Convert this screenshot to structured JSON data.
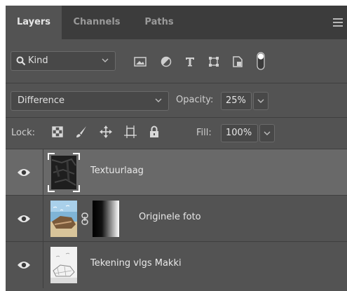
{
  "tabs": [
    {
      "label": "Layers",
      "active": true
    },
    {
      "label": "Channels",
      "active": false
    },
    {
      "label": "Paths",
      "active": false
    }
  ],
  "filter": {
    "kind_label": "Kind",
    "icons": [
      "image-filter-icon",
      "adjustment-filter-icon",
      "type-filter-icon",
      "shape-filter-icon",
      "smart-object-filter-icon",
      "filter-toggle-icon"
    ]
  },
  "blend": {
    "mode": "Difference",
    "opacity_label": "Opacity:",
    "opacity_value": "25%"
  },
  "lock": {
    "label": "Lock:",
    "icons": [
      "lock-transparent-pixels-icon",
      "lock-image-pixels-icon",
      "lock-position-icon",
      "lock-artboard-icon",
      "lock-all-icon"
    ],
    "fill_label": "Fill:",
    "fill_value": "100%"
  },
  "layers": [
    {
      "name": "Textuurlaag",
      "selected": true,
      "has_mask": false
    },
    {
      "name": "Originele foto",
      "selected": false,
      "has_mask": true
    },
    {
      "name": "Tekening vlgs Makki",
      "selected": false,
      "has_mask": false
    }
  ],
  "colors": {
    "panel_bg": "#535353",
    "tab_bar_bg": "#3c3c3c",
    "selected_layer_bg": "#696969"
  }
}
